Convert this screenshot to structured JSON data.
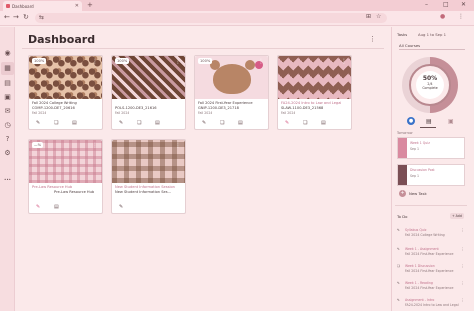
{
  "browser": {
    "tab_title": "Dashboard",
    "new_tab": "+",
    "win_min": "–",
    "win_max": "□",
    "win_close": "✕",
    "tab_close": "✕"
  },
  "page": {
    "title": "Dashboard",
    "menu": "⋮"
  },
  "cards": [
    {
      "title": "Fall 2024 College Writing",
      "code": "COMP-1200-DE7_20616",
      "term": "Fall 2024",
      "progress": "100%",
      "name_color": "#4a3a3c"
    },
    {
      "title": "",
      "code": "POLS-1200-DE3_21616",
      "term": "Fall 2024",
      "progress": "100%",
      "name_color": "#4a3a3c"
    },
    {
      "title": "Fall 2024 First-Year Experience",
      "code": "GNIP-1200-DE3_21718",
      "term": "Fall 2024",
      "progress": "100%",
      "name_color": "#4a3a3c"
    },
    {
      "title": "FA24-2024 Intro to Law and Legal",
      "code": "SLAW-1100-DE3_21568",
      "term": "Fall 2024",
      "progress": "",
      "name_color": "#c0708a"
    },
    {
      "title": "Pre-Law Resource Hub",
      "code": "Pre-Law Resource Hub",
      "term": "",
      "progress": "—%",
      "name_color": "#c0708a"
    },
    {
      "title": "New Student Information Session",
      "code": "New Student Information Ses…",
      "term": "",
      "progress": "",
      "name_color": "#c0708a"
    }
  ],
  "right": {
    "tasks_label": "Tasks",
    "date_range": "Aug 1 to Sep 1",
    "all_courses": "All Courses",
    "ring_percent": "50%",
    "ring_label": "Complete",
    "ring_sub": "2/4",
    "tomorrow_label": "Tomorrow",
    "new_task": "New Task",
    "todo_title": "To Do",
    "todo_add": "+ Add",
    "tasks": [
      {
        "title": "Week 1 Quiz",
        "date": "Sep 1"
      },
      {
        "title": "Discussion Post",
        "date": "Sep 1"
      }
    ],
    "todos": [
      {
        "title": "Syllabus Quiz",
        "course": "Fall 2024 College Writing",
        "due": ""
      },
      {
        "title": "Week 1 - Assignment",
        "course": "Fall 2024 First-Year Experience",
        "due": ""
      },
      {
        "title": "Week 1 Discussion",
        "course": "Fall 2024 First-Year Experience",
        "due": ""
      },
      {
        "title": "Week 1 - Reading",
        "course": "Fall 2024 First-Year Experience",
        "due": ""
      },
      {
        "title": "Assignment - Intro",
        "course": "FA24-2024 Intro to Law and Legal",
        "due": ""
      }
    ]
  },
  "icons": {
    "back": "←",
    "forward": "→",
    "reload": "↻",
    "site": "⇆",
    "star": "☆",
    "ext": "⊞",
    "profile": "●",
    "more": "⋮",
    "account": "◉",
    "dashboard": "▦",
    "courses": "▤",
    "calendar": "▣",
    "inbox": "✉",
    "history": "◷",
    "help": "?",
    "mail": "✉",
    "apps": "⚙",
    "dots": "•••",
    "assignment": "✎",
    "discussion": "❏",
    "files": "▤"
  }
}
